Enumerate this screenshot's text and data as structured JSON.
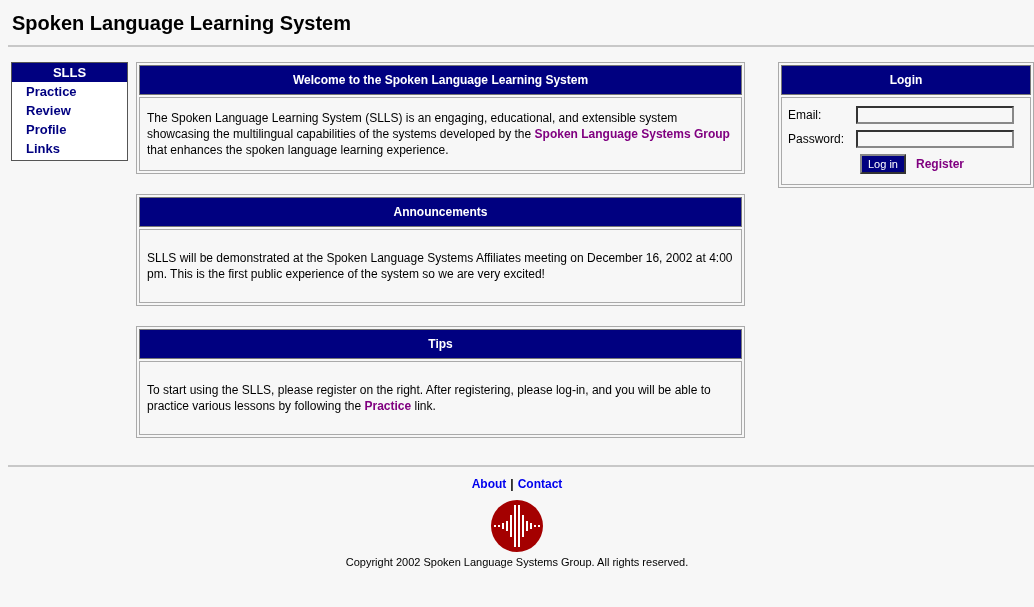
{
  "header": {
    "title": "Spoken Language Learning System"
  },
  "sidebar": {
    "title": "SLLS",
    "items": [
      {
        "label": "Practice"
      },
      {
        "label": "Review"
      },
      {
        "label": "Profile"
      },
      {
        "label": "Links"
      }
    ]
  },
  "panels": [
    {
      "title": "Welcome to the Spoken Language Learning System",
      "body": [
        {
          "kind": "text",
          "text": "The Spoken Language Learning System (SLLS) is an engaging, educational, and extensible system showcasing the multilingual capabilities of the systems developed by the "
        },
        {
          "kind": "link",
          "text": "Spoken Language Systems Group"
        },
        {
          "kind": "text",
          "text": " that enhances the spoken language learning experience."
        }
      ]
    },
    {
      "title": "Announcements",
      "body": [
        {
          "kind": "text",
          "text": "SLLS will be demonstrated at the Spoken Language Systems Affiliates meeting on December 16, 2002 at 4:00 pm. This is the first public experience of the system so we are very excited!"
        }
      ]
    },
    {
      "title": "Tips",
      "body": [
        {
          "kind": "text",
          "text": "To start using the SLLS, please register on the right. After registering, please log-in, and you will be able to practice various lessons by following the "
        },
        {
          "kind": "link",
          "text": "Practice"
        },
        {
          "kind": "text",
          "text": " link."
        }
      ]
    }
  ],
  "login": {
    "title": "Login",
    "email_label": "Email:",
    "password_label": "Password:",
    "button": "Log in",
    "register": "Register"
  },
  "footer": {
    "links": [
      "About",
      "Contact"
    ],
    "separator": "|",
    "copyright": "Copyright 2002 Spoken Language Systems Group. All rights reserved."
  }
}
